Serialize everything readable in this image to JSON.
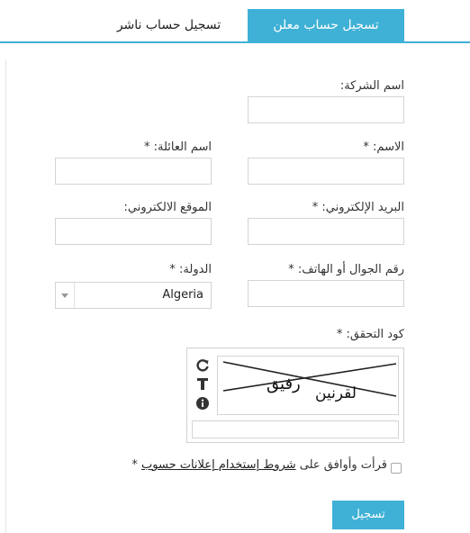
{
  "tabs": {
    "advertiser": "تسجيل حساب معلن",
    "publisher": "تسجيل حساب ناشر"
  },
  "form": {
    "company_label": "اسم الشركة:",
    "first_name_label": "الاسم: *",
    "last_name_label": "اسم العائلة: *",
    "email_label": "البريد الإلكتروني: *",
    "website_label": "الموقع الالكتروني:",
    "phone_label": "رقم الجوال أو الهاتف: *",
    "country_label": "الدولة: *",
    "country_value": "Algeria",
    "captcha_label": "كود التحقق: *",
    "captcha_word_1": "لقرنين",
    "captcha_word_2": "رفيق",
    "captcha_icons": [
      "refresh-icon",
      "text-icon",
      "info-icon"
    ],
    "agree_prefix": "قرأت وأوافق على",
    "agree_link": "شروط إستخدام إعلانات حسوب",
    "agree_star": "*",
    "submit_label": "تسجيل"
  },
  "colors": {
    "accent": "#3fb1d6",
    "border": "#d4d4d4"
  }
}
